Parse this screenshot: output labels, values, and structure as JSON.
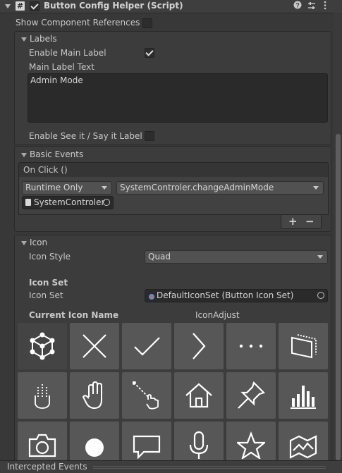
{
  "header": {
    "title": "Button Config Helper (Script)",
    "script_icon": "#"
  },
  "show_component_references": {
    "label": "Show Component References",
    "checked": false
  },
  "labels": {
    "title": "Labels",
    "enable_main_label": {
      "label": "Enable Main Label",
      "checked": true
    },
    "main_label_text_label": "Main Label Text",
    "main_label_text_value": "Admin Mode",
    "enable_see_it_say_it": {
      "label": "Enable See it / Say it Label",
      "checked": false
    }
  },
  "basic_events": {
    "title": "Basic Events",
    "event_name": "On Click ()",
    "runtime_dropdown": "Runtime Only",
    "method_dropdown": "SystemControler.changeAdminMode",
    "target_object": "SystemControler",
    "add_label": "+",
    "remove_label": "−"
  },
  "icon": {
    "title": "Icon",
    "icon_style_label": "Icon Style",
    "icon_style_value": "Quad",
    "icon_set_header": "Icon Set",
    "icon_set_label": "Icon Set",
    "icon_set_value": "DefaultIconSet (Button Icon Set)",
    "current_icon_name_label": "Current Icon Name",
    "current_icon_name_value": "IconAdjust",
    "icons": [
      "adjust-cube",
      "close",
      "check",
      "chevron-right",
      "more",
      "hologram",
      "hand-ray",
      "hand",
      "hand-pointer",
      "home",
      "pin",
      "bar-chart",
      "camera",
      "circle",
      "speech-bubble",
      "microphone",
      "star",
      "map"
    ]
  },
  "footer": {
    "label": "Intercepted Events"
  }
}
